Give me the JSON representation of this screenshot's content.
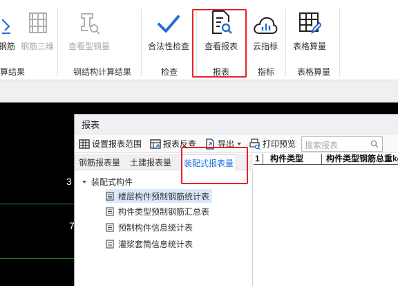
{
  "ribbon": {
    "buttons": {
      "rebar": "钢筋",
      "rebar_3d": "钢筋三维",
      "view_steel": "查看型钢量",
      "legality_check": "合法性检查",
      "view_report": "查看报表",
      "cloud_indicator": "云指标",
      "table_quantity": "表格算量"
    },
    "groups": {
      "calc_results": "算结果",
      "steel_calc_results": "钢结构计算结果",
      "check": "检查",
      "report": "报表",
      "indicator": "指标",
      "table_quantity": "表格算量"
    }
  },
  "canvas": {
    "label_top": "3",
    "label_mid": "7"
  },
  "dialog": {
    "title": "报表",
    "toolbar": {
      "set_scope": "设置报表范围",
      "reverse_check": "报表反查",
      "export": "导出",
      "print_preview": "打印预览",
      "search_placeholder": "搜索报表"
    },
    "tabs": {
      "rebar_report": "钢筋报表量",
      "civil_report": "土建报表量",
      "prefab_report": "装配式报表量"
    },
    "tree": {
      "root": "装配式构件",
      "items": [
        "楼层构件预制钢筋统计表",
        "构件类型预制钢筋汇总表",
        "预制构件信息统计表",
        "灌浆套筒信息统计表"
      ]
    },
    "grid": {
      "row_num": "1",
      "col1": "构件类型",
      "col2": "构件类型钢筋总重kg"
    }
  },
  "colors": {
    "accent": "#1a73e8",
    "highlight": "#e8202a",
    "canvas": "#000000",
    "grid_line": "#1a8f2a"
  }
}
